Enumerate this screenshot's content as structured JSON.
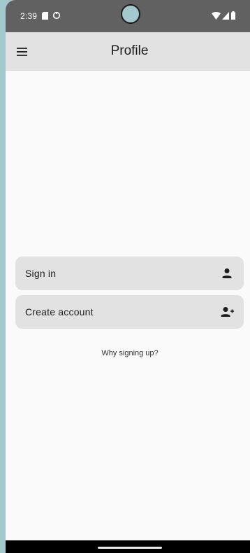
{
  "status_bar": {
    "time": "2:39",
    "icons": [
      "sd-card-icon",
      "sync-icon",
      "wifi-icon",
      "signal-icon",
      "battery-icon"
    ]
  },
  "app_bar": {
    "title": "Profile",
    "menu_icon": "menu-icon"
  },
  "actions": [
    {
      "label": "Sign in",
      "icon": "person-icon"
    },
    {
      "label": "Create account",
      "icon": "person-add-icon"
    }
  ],
  "help_link": "Why signing up?",
  "colors": {
    "status_bar_bg": "#616161",
    "app_bar_bg": "#e2e2e2",
    "content_bg": "#fafafa",
    "row_bg": "#e2e2e2",
    "frame_bg": "#a3c9cf"
  }
}
